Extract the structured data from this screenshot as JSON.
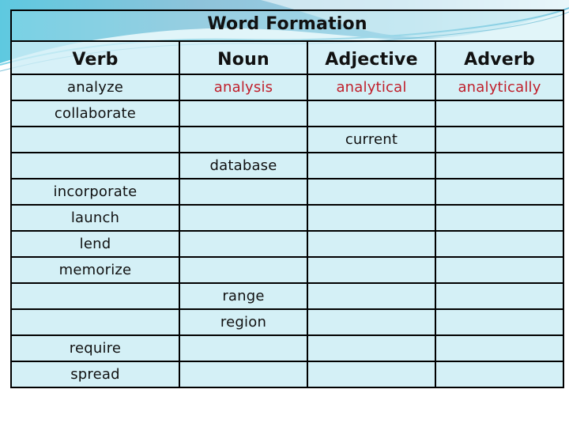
{
  "title": "Word Formation",
  "columns": [
    "Verb",
    "Noun",
    "Adjective",
    "Adverb"
  ],
  "rows": [
    {
      "verb": "analyze",
      "noun": "analysis",
      "adjective": "analytical",
      "adverb": "analytically",
      "highlight": true
    },
    {
      "verb": "collaborate",
      "noun": "",
      "adjective": "",
      "adverb": ""
    },
    {
      "verb": "",
      "noun": "",
      "adjective": "current",
      "adverb": ""
    },
    {
      "verb": "",
      "noun": "database",
      "adjective": "",
      "adverb": ""
    },
    {
      "verb": "incorporate",
      "noun": "",
      "adjective": "",
      "adverb": ""
    },
    {
      "verb": "launch",
      "noun": "",
      "adjective": "",
      "adverb": ""
    },
    {
      "verb": "lend",
      "noun": "",
      "adjective": "",
      "adverb": ""
    },
    {
      "verb": "memorize",
      "noun": "",
      "adjective": "",
      "adverb": ""
    },
    {
      "verb": "",
      "noun": "range",
      "adjective": "",
      "adverb": ""
    },
    {
      "verb": "",
      "noun": "region",
      "adjective": "",
      "adverb": ""
    },
    {
      "verb": "require",
      "noun": "",
      "adjective": "",
      "adverb": ""
    },
    {
      "verb": "spread",
      "noun": "",
      "adjective": "",
      "adverb": ""
    }
  ],
  "colors": {
    "highlight_text": "#c0202c",
    "cell_background": "#c8ecf4",
    "wave_dark": "#5fb8d6",
    "wave_light": "#bfe8f2"
  }
}
